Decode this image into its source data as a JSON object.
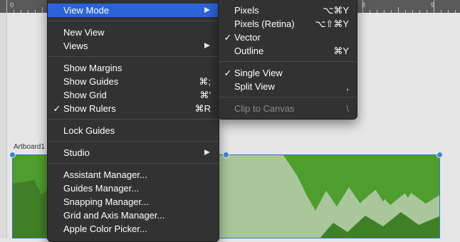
{
  "ruler": {
    "numbers": [
      "0",
      "8",
      "9"
    ]
  },
  "artboard": {
    "label": "Artboard1"
  },
  "view_menu": {
    "view_mode": "View Mode",
    "new_view": "New View",
    "views": "Views",
    "show_margins": "Show Margins",
    "show_guides": "Show Guides",
    "show_guides_sc": "⌘;",
    "show_grid": "Show Grid",
    "show_grid_sc": "⌘'",
    "show_rulers": "Show Rulers",
    "show_rulers_sc": "⌘R",
    "lock_guides": "Lock Guides",
    "studio": "Studio",
    "assistant_manager": "Assistant Manager...",
    "guides_manager": "Guides Manager...",
    "snapping_manager": "Snapping Manager...",
    "grid_axis_manager": "Grid and Axis Manager...",
    "apple_color_picker": "Apple Color Picker..."
  },
  "view_mode_submenu": {
    "pixels": "Pixels",
    "pixels_sc": "⌥⌘Y",
    "pixels_retina": "Pixels (Retina)",
    "pixels_retina_sc": "⌥⇧⌘Y",
    "vector": "Vector",
    "outline": "Outline",
    "outline_sc": "⌘Y",
    "single_view": "Single View",
    "split_view": "Split View",
    "split_view_sc": ",",
    "clip_to_canvas": "Clip to Canvas",
    "clip_to_canvas_sc": "\\"
  },
  "check_glyph": "✓",
  "colors": {
    "menu_bg": "#323232",
    "highlight": "#2b63d9",
    "artboard_green": "#4f9d2f",
    "handle_blue": "#3b86d6"
  }
}
